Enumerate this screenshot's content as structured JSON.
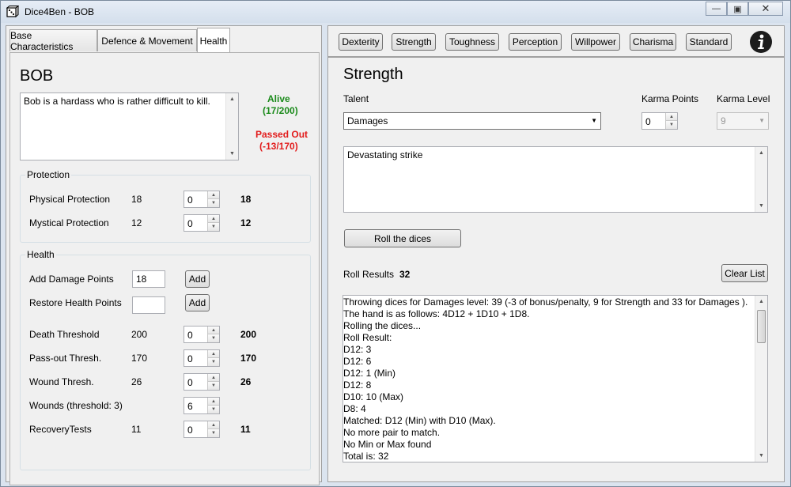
{
  "window": {
    "title": "Dice4Ben - BOB"
  },
  "left": {
    "tabs": [
      "Base Characteristics",
      "Defence & Movement",
      "Health"
    ],
    "character_name": "BOB",
    "description": "Bob is a hardass who is rather difficult to kill.",
    "status": {
      "alive": "Alive",
      "alive_value": "(17/200)",
      "passed_out": "Passed Out",
      "passed_out_value": "(-13/170)"
    },
    "protection": {
      "title": "Protection",
      "rows": [
        {
          "label": "Physical Protection",
          "base": "18",
          "mod": "0",
          "total": "18"
        },
        {
          "label": "Mystical Protection",
          "base": "12",
          "mod": "0",
          "total": "12"
        }
      ]
    },
    "health": {
      "title": "Health",
      "add_damage_label": "Add Damage Points",
      "add_damage_value": "18",
      "restore_label": "Restore Health Points",
      "restore_value": "",
      "add_button": "Add",
      "rows": [
        {
          "label": "Death Threshold",
          "base": "200",
          "mod": "0",
          "total": "200"
        },
        {
          "label": "Pass-out Thresh.",
          "base": "170",
          "mod": "0",
          "total": "170"
        },
        {
          "label": "Wound Thresh.",
          "base": "26",
          "mod": "0",
          "total": "26"
        },
        {
          "label": "Wounds (threshold: 3)",
          "base": "",
          "mod": "6",
          "total": ""
        },
        {
          "label": "RecoveryTests",
          "base": "11",
          "mod": "0",
          "total": "11"
        }
      ]
    }
  },
  "right": {
    "attribute_buttons": [
      "Dexterity",
      "Strength",
      "Toughness",
      "Perception",
      "Willpower",
      "Charisma",
      "Standard"
    ],
    "info_icon": "info-icon",
    "heading": "Strength",
    "talent_label": "Talent",
    "talent_value": "Damages",
    "karma_points_label": "Karma Points",
    "karma_points_value": "0",
    "karma_level_label": "Karma Level",
    "karma_level_value": "9",
    "talent_description": "Devastating strike",
    "roll_button": "Roll the dices",
    "roll_results_label": "Roll Results",
    "roll_results_value": "32",
    "clear_button": "Clear List",
    "result_lines": [
      "Throwing dices for Damages  level: 39 (-3 of bonus/penalty, 9 for Strength and 33 for Damages ).",
      "The hand is as follows: 4D12 + 1D10 + 1D8.",
      "Rolling the dices...",
      "Roll Result:",
      "D12: 3",
      "D12: 6",
      "D12: 1   (Min)",
      "D12: 8",
      "D10: 10   (Max)",
      "D8: 4",
      "Matched: D12 (Min) with D10 (Max).",
      "No more pair to match.",
      "No Min or Max found",
      "Total is: 32"
    ]
  },
  "colors": {
    "alive": "#1a8a1a",
    "passed_out": "#e21b1b"
  }
}
